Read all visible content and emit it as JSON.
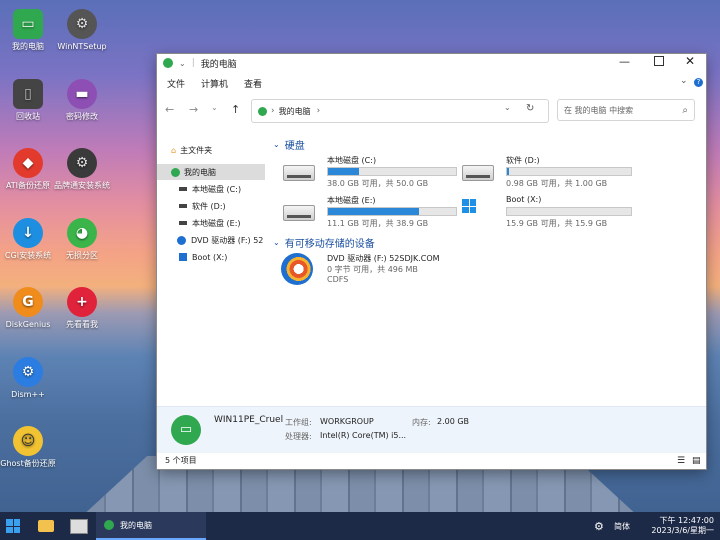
{
  "desktop": {
    "icons": [
      {
        "label": "我的电脑"
      },
      {
        "label": "WinNTSetup"
      },
      {
        "label": "回收站"
      },
      {
        "label": "密码修改"
      },
      {
        "label": "ATI备份还原"
      },
      {
        "label": "品牌通安装系统"
      },
      {
        "label": "CGI安装系统"
      },
      {
        "label": "无损分区"
      },
      {
        "label": "DiskGenius"
      },
      {
        "label": "先看看我"
      },
      {
        "label": "Dism++"
      },
      {
        "label": "Ghost备份还原"
      }
    ]
  },
  "window": {
    "title": "我的电脑",
    "menu": [
      "文件",
      "计算机",
      "查看"
    ],
    "address": "我的电脑",
    "address_sep": "›",
    "search_placeholder": "在 我的电脑 中搜索",
    "sidebar": [
      {
        "label": "主文件夹"
      },
      {
        "label": "我的电脑"
      },
      {
        "label": "本地磁盘 (C:)"
      },
      {
        "label": "软件 (D:)"
      },
      {
        "label": "本地磁盘 (E:)"
      },
      {
        "label": "DVD 驱动器 (F:) 52"
      },
      {
        "label": "Boot (X:)"
      }
    ],
    "sections": {
      "hard_disks": "硬盘",
      "removable": "有可移动存储的设备"
    },
    "drives": [
      {
        "name": "本地磁盘 (C:)",
        "size": "38.0 GB 可用，共 50.0 GB",
        "used_fraction": 0.24
      },
      {
        "name": "软件 (D:)",
        "size": "0.98 GB 可用，共 1.00 GB",
        "used_fraction": 0.02
      },
      {
        "name": "本地磁盘 (E:)",
        "size": "11.1 GB 可用，共 38.9 GB",
        "used_fraction": 0.71
      },
      {
        "name": "Boot (X:)",
        "size": "15.9 GB 可用，共 15.9 GB",
        "used_fraction": 0.0
      }
    ],
    "dvd": {
      "name": "DVD 驱动器 (F:) 52SDJK.COM",
      "size": "0 字节 可用，共 496 MB",
      "fs": "CDFS"
    },
    "details": {
      "computer_name": "WIN11PE_Cruel",
      "workgroup_label": "工作组:",
      "workgroup": "WORKGROUP",
      "memory_label": "内存:",
      "memory": "2.00 GB",
      "cpu_label": "处理器:",
      "cpu": "Intel(R) Core(TM) i5..."
    },
    "status": "5 个项目"
  },
  "taskbar": {
    "active_app": "我的电脑",
    "tray_text": "简体",
    "time": "下午 12:47:00",
    "date": "2023/3/6/星期一"
  },
  "colors": {
    "accent": "#2b88d8",
    "taskbar": "#1d2a47",
    "section": "#1a4fa0"
  }
}
